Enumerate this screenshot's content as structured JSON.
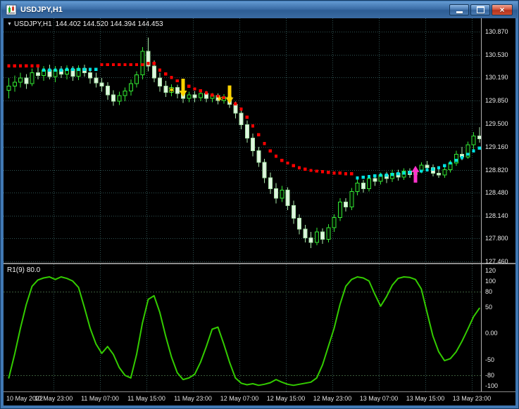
{
  "window": {
    "title": "USDJPY,H1",
    "controls": {
      "close_glyph": "×"
    }
  },
  "chart": {
    "menu_icon": "▼",
    "symbol_label": "USDJPY,H1",
    "ohlc_label": "144.402 144.520 144.394 144.453"
  },
  "indicator": {
    "label": "R1(9) 80.0"
  },
  "chart_data": [
    {
      "type": "candlestick",
      "title": "USDJPY H1",
      "ylim": [
        127.439,
        131.068
      ],
      "price_ticks": [
        "130.870",
        "130.530",
        "130.190",
        "129.850",
        "129.500",
        "129.160",
        "128.820",
        "128.480",
        "128.140",
        "127.800",
        "127.460"
      ],
      "time_labels": [
        "10 May 2022",
        "10 May 23:00",
        "11 May 07:00",
        "11 May 15:00",
        "11 May 23:00",
        "12 May 07:00",
        "12 May 15:00",
        "12 May 23:00",
        "13 May 07:00",
        "13 May 15:00",
        "13 May 23:00"
      ],
      "grid_bar_indices": [
        8,
        16,
        24,
        32,
        40,
        48,
        56,
        64,
        72,
        80
      ],
      "colors": {
        "background": "#000000",
        "grid": "#2f5252",
        "bull_border": "#33e633",
        "bull_fill": "#001400",
        "bear_border": "#a8e6a8",
        "bear_fill": "#dff5df",
        "dots_down": "#ff0000",
        "dots_up": "#00e0e0"
      },
      "candles": [
        [
          130.0,
          130.18,
          129.88,
          130.06
        ],
        [
          130.06,
          130.22,
          129.98,
          130.12
        ],
        [
          130.12,
          130.26,
          130.04,
          130.18
        ],
        [
          130.18,
          130.24,
          130.02,
          130.1
        ],
        [
          130.1,
          130.32,
          130.06,
          130.26
        ],
        [
          130.26,
          130.36,
          130.16,
          130.22
        ],
        [
          130.22,
          130.36,
          130.14,
          130.3
        ],
        [
          130.3,
          130.38,
          130.16,
          130.2
        ],
        [
          130.2,
          130.36,
          130.12,
          130.3
        ],
        [
          130.3,
          130.36,
          130.18,
          130.24
        ],
        [
          130.24,
          130.37,
          130.16,
          130.31
        ],
        [
          130.31,
          130.36,
          130.14,
          130.21
        ],
        [
          130.21,
          130.37,
          130.15,
          130.32
        ],
        [
          130.32,
          130.38,
          130.2,
          130.26
        ],
        [
          130.26,
          130.32,
          130.1,
          130.18
        ],
        [
          130.18,
          130.26,
          130.04,
          130.11
        ],
        [
          130.11,
          130.18,
          129.98,
          130.06
        ],
        [
          130.06,
          130.12,
          129.86,
          129.93
        ],
        [
          129.93,
          130.0,
          129.77,
          129.84
        ],
        [
          129.84,
          129.98,
          129.78,
          129.92
        ],
        [
          129.92,
          130.04,
          129.84,
          129.99
        ],
        [
          129.99,
          130.16,
          129.92,
          130.1
        ],
        [
          130.1,
          130.28,
          130.04,
          130.23
        ],
        [
          130.23,
          130.64,
          130.16,
          130.58
        ],
        [
          130.58,
          130.78,
          130.28,
          130.36
        ],
        [
          130.36,
          130.44,
          130.12,
          130.18
        ],
        [
          130.18,
          130.26,
          129.98,
          130.06
        ],
        [
          130.06,
          130.14,
          129.9,
          129.97
        ],
        [
          129.97,
          130.09,
          129.91,
          130.04
        ],
        [
          130.04,
          130.08,
          129.88,
          129.95
        ],
        [
          129.95,
          130.01,
          129.81,
          129.88
        ],
        [
          129.88,
          129.98,
          129.82,
          129.93
        ],
        [
          129.93,
          129.99,
          129.82,
          129.89
        ],
        [
          129.89,
          129.99,
          129.84,
          129.95
        ],
        [
          129.95,
          129.99,
          129.82,
          129.88
        ],
        [
          129.88,
          129.96,
          129.82,
          129.92
        ],
        [
          129.92,
          129.95,
          129.79,
          129.85
        ],
        [
          129.85,
          129.94,
          129.8,
          129.9
        ],
        [
          129.9,
          129.93,
          129.74,
          129.79
        ],
        [
          129.79,
          129.83,
          129.58,
          129.66
        ],
        [
          129.66,
          129.7,
          129.42,
          129.49
        ],
        [
          129.49,
          129.55,
          129.22,
          129.29
        ],
        [
          129.29,
          129.36,
          129.02,
          129.1
        ],
        [
          129.1,
          129.16,
          128.86,
          128.93
        ],
        [
          128.93,
          128.98,
          128.62,
          128.7
        ],
        [
          128.7,
          128.78,
          128.46,
          128.54
        ],
        [
          128.54,
          128.62,
          128.32,
          128.4
        ],
        [
          128.4,
          128.58,
          128.34,
          128.52
        ],
        [
          128.52,
          128.56,
          128.22,
          128.29
        ],
        [
          128.29,
          128.36,
          128.02,
          128.1
        ],
        [
          128.1,
          128.16,
          127.86,
          127.94
        ],
        [
          127.94,
          128.0,
          127.74,
          127.81
        ],
        [
          127.81,
          127.9,
          127.66,
          127.74
        ],
        [
          127.74,
          127.96,
          127.7,
          127.9
        ],
        [
          127.9,
          127.95,
          127.72,
          127.79
        ],
        [
          127.79,
          128.01,
          127.74,
          127.96
        ],
        [
          127.96,
          128.16,
          127.9,
          128.11
        ],
        [
          128.11,
          128.4,
          128.06,
          128.34
        ],
        [
          128.34,
          128.4,
          128.2,
          128.27
        ],
        [
          128.27,
          128.55,
          128.22,
          128.5
        ],
        [
          128.5,
          128.68,
          128.44,
          128.62
        ],
        [
          128.62,
          128.67,
          128.48,
          128.54
        ],
        [
          128.54,
          128.74,
          128.5,
          128.69
        ],
        [
          128.69,
          128.75,
          128.58,
          128.65
        ],
        [
          128.65,
          128.78,
          128.6,
          128.74
        ],
        [
          128.74,
          128.79,
          128.62,
          128.69
        ],
        [
          128.69,
          128.82,
          128.64,
          128.77
        ],
        [
          128.77,
          128.82,
          128.66,
          128.71
        ],
        [
          128.71,
          128.84,
          128.67,
          128.8
        ],
        [
          128.8,
          128.84,
          128.7,
          128.75
        ],
        [
          128.75,
          128.86,
          128.68,
          128.81
        ],
        [
          128.81,
          128.93,
          128.77,
          128.89
        ],
        [
          128.89,
          128.95,
          128.8,
          128.85
        ],
        [
          128.85,
          128.9,
          128.72,
          128.77
        ],
        [
          128.77,
          128.84,
          128.7,
          128.74
        ],
        [
          128.74,
          128.86,
          128.7,
          128.82
        ],
        [
          128.82,
          128.96,
          128.78,
          128.92
        ],
        [
          128.92,
          129.1,
          128.88,
          129.05
        ],
        [
          129.05,
          129.16,
          128.96,
          129.01
        ],
        [
          129.01,
          129.24,
          128.98,
          129.19
        ],
        [
          129.19,
          129.38,
          129.12,
          129.32
        ],
        [
          129.32,
          129.45,
          129.22,
          129.28
        ]
      ],
      "dots_down": [
        [
          0,
          130.36
        ],
        [
          1,
          130.36
        ],
        [
          2,
          130.36
        ],
        [
          3,
          130.36
        ],
        [
          4,
          130.36
        ],
        [
          5,
          130.36
        ],
        [
          16,
          130.38
        ],
        [
          17,
          130.38
        ],
        [
          18,
          130.38
        ],
        [
          19,
          130.38
        ],
        [
          20,
          130.38
        ],
        [
          21,
          130.38
        ],
        [
          22,
          130.38
        ],
        [
          23,
          130.38
        ],
        [
          24,
          130.4
        ],
        [
          25,
          130.4
        ],
        [
          26,
          130.3
        ],
        [
          27,
          130.24
        ],
        [
          28,
          130.19
        ],
        [
          29,
          130.14
        ],
        [
          30,
          130.1
        ],
        [
          31,
          130.06
        ],
        [
          32,
          130.02
        ],
        [
          33,
          129.99
        ],
        [
          34,
          129.96
        ],
        [
          35,
          129.93
        ],
        [
          36,
          129.91
        ],
        [
          37,
          129.89
        ],
        [
          38,
          129.86
        ],
        [
          39,
          129.8
        ],
        [
          40,
          129.72
        ],
        [
          41,
          129.6
        ],
        [
          42,
          129.47
        ],
        [
          43,
          129.34
        ],
        [
          44,
          129.21
        ],
        [
          45,
          129.1
        ],
        [
          46,
          129.02
        ],
        [
          47,
          128.96
        ],
        [
          48,
          128.92
        ],
        [
          49,
          128.88
        ],
        [
          50,
          128.85
        ],
        [
          51,
          128.83
        ],
        [
          52,
          128.81
        ],
        [
          53,
          128.8
        ],
        [
          54,
          128.79
        ],
        [
          55,
          128.78
        ],
        [
          56,
          128.77
        ],
        [
          57,
          128.77
        ],
        [
          58,
          128.76
        ],
        [
          59,
          128.76
        ]
      ],
      "dots_up": [
        [
          6,
          130.3
        ],
        [
          7,
          130.3
        ],
        [
          8,
          130.3
        ],
        [
          9,
          130.3
        ],
        [
          10,
          130.31
        ],
        [
          11,
          130.31
        ],
        [
          12,
          130.31
        ],
        [
          13,
          130.31
        ],
        [
          14,
          130.31
        ],
        [
          15,
          130.31
        ],
        [
          60,
          128.7
        ],
        [
          61,
          128.71
        ],
        [
          62,
          128.72
        ],
        [
          63,
          128.73
        ],
        [
          64,
          128.74
        ],
        [
          65,
          128.74
        ],
        [
          66,
          128.75
        ],
        [
          67,
          128.76
        ],
        [
          68,
          128.77
        ],
        [
          69,
          128.78
        ],
        [
          70,
          128.79
        ],
        [
          71,
          128.8
        ],
        [
          72,
          128.82
        ],
        [
          73,
          128.83
        ],
        [
          74,
          128.85
        ],
        [
          75,
          128.88
        ],
        [
          76,
          128.92
        ],
        [
          77,
          128.96
        ],
        [
          78,
          129.0
        ],
        [
          79,
          129.05
        ],
        [
          80,
          129.1
        ],
        [
          81,
          129.14
        ]
      ],
      "markers": [
        {
          "type": "star",
          "name": "sell-star-icon",
          "glyph": "✶",
          "i": 29,
          "price": 130.0,
          "dx": -8,
          "color": "#ffd400"
        },
        {
          "type": "arrow-down",
          "name": "sell-arrow-icon",
          "i": 30,
          "price": 129.9,
          "dx": 0,
          "color": "#ffd400"
        },
        {
          "type": "star",
          "name": "sell-star-icon",
          "glyph": "✶",
          "i": 37,
          "price": 129.87,
          "dx": -6,
          "color": "#ffd400"
        },
        {
          "type": "arrow-down",
          "name": "sell-arrow-icon",
          "i": 38,
          "price": 129.8,
          "dx": 0,
          "color": "#ffd400"
        },
        {
          "type": "arrow-up",
          "name": "buy-arrow-icon",
          "i": 70,
          "price": 128.88,
          "dx": 0,
          "color": "#ff33cc"
        }
      ]
    },
    {
      "type": "line",
      "label": "R1(9) 80.0",
      "color": "#33cc00",
      "ylim": [
        -110.7,
        132.1
      ],
      "ticks": [
        "120",
        "100",
        "80",
        "50",
        "0.00",
        "-50",
        "-80",
        "-100"
      ],
      "levels": [
        80,
        -80
      ],
      "values": [
        -85,
        -40,
        10,
        55,
        90,
        102,
        106,
        108,
        103,
        108,
        105,
        100,
        88,
        50,
        10,
        -20,
        -38,
        -25,
        -40,
        -65,
        -80,
        -85,
        -40,
        20,
        65,
        72,
        40,
        -5,
        -45,
        -75,
        -88,
        -85,
        -78,
        -55,
        -25,
        8,
        12,
        -20,
        -55,
        -85,
        -95,
        -98,
        -96,
        -99,
        -97,
        -94,
        -88,
        -93,
        -97,
        -99,
        -97,
        -95,
        -93,
        -85,
        -60,
        -25,
        10,
        55,
        90,
        103,
        108,
        106,
        100,
        75,
        52,
        70,
        92,
        105,
        108,
        107,
        103,
        85,
        40,
        -5,
        -35,
        -52,
        -48,
        -35,
        -15,
        8,
        32,
        48
      ]
    }
  ]
}
